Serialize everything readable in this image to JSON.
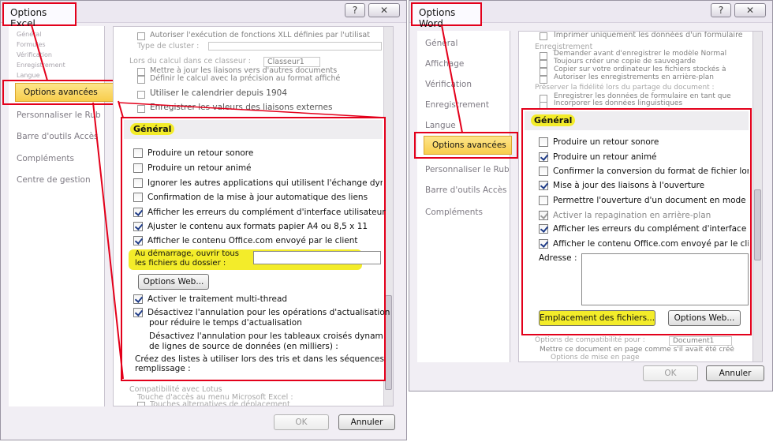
{
  "excel": {
    "title": "Options Excel",
    "help": "?",
    "nav": {
      "faded_top": [
        "Général",
        "Formules",
        "Vérification",
        "Enregistrement",
        "Langue"
      ],
      "selected": "Options avancées",
      "items": [
        "Personnaliser le Rub",
        "Barre d'outils Accès",
        "Compléments",
        "Centre de gestion"
      ]
    },
    "above": {
      "r1": "Autoriser l'exécution de fonctions XLL définies par l'utilisat",
      "r2": "Type de cluster :",
      "r3": "Lors du calcul dans ce classeur :",
      "r3b": "Classeur1",
      "r4": "Mettre à jour les liaisons vers d'autres documents",
      "r5": "Définir le calcul avec la précision au format affiché",
      "r6": "Utiliser le calendrier depuis 1904",
      "r7": "Enregistrer les valeurs des liaisons externes"
    },
    "section_title": "Général",
    "options": [
      {
        "label": "Produire un retour sonore",
        "checked": false
      },
      {
        "label": "Produire un retour animé",
        "checked": false
      },
      {
        "label": "Ignorer les autres applications qui utilisent l'échange dyna",
        "checked": false
      },
      {
        "label": "Confirmation de la mise à jour automatique des liens",
        "checked": false
      },
      {
        "label": "Afficher les erreurs du complément d'interface utilisateur",
        "checked": true
      },
      {
        "label": "Ajuster le contenu aux formats papier A4 ou 8,5 x 11",
        "checked": true
      },
      {
        "label": "Afficher le contenu Office.com envoyé par le client",
        "checked": true
      }
    ],
    "startup_label_1": "Au démarrage, ouvrir tous",
    "startup_label_2": "les fichiers du dossier :",
    "web_button": "Options Web...",
    "options2": [
      {
        "label": "Activer le traitement multi-thread",
        "checked": true
      },
      {
        "label": "Désactivez l'annulation pour les opérations d'actualisation",
        "checked": true
      }
    ],
    "opt2_cont": "pour réduire le temps d'actualisation",
    "note1a": "Désactivez l'annulation pour les tableaux croisés dynamiques",
    "note1b": "de lignes de source de données (en milliers) :",
    "note2a": "Créez des listes à utiliser lors des tris et dans les séquences de",
    "note2b": "remplissage :",
    "below": {
      "r1": "Compatibilité avec Lotus",
      "r2": "Touche d'accès au menu Microsoft Excel :",
      "r3": "Touches alternatives de déplacement"
    },
    "ok": "OK",
    "cancel": "Annuler"
  },
  "word": {
    "title": "Options Word",
    "help": "?",
    "nav": {
      "items_top": [
        "Général",
        "Affichage",
        "Vérification",
        "Enregistrement",
        "Langue"
      ],
      "selected": "Options avancées",
      "items": [
        "Personnaliser le Rub",
        "Barre d'outils Accès",
        "Compléments"
      ]
    },
    "above": {
      "r1": "Imprimer uniquement les données d'un formulaire",
      "r2": "Enregistrement",
      "r3": "Demander avant d'enregistrer le modèle Normal",
      "r4": "Toujours créer une copie de sauvegarde",
      "r5": "Copier sur votre ordinateur les fichiers stockés à",
      "r6": "Autoriser les enregistrements en arrière-plan",
      "r7": "Préserver la fidélité lors du partage du document :",
      "r8": "Enregistrer les données de formulaire en tant que",
      "r9": "Incorporer les données linguistiques"
    },
    "section_title": "Général",
    "options": [
      {
        "label": "Produire un retour sonore",
        "checked": false,
        "disabled": false
      },
      {
        "label": "Produire un retour animé",
        "checked": true,
        "disabled": false
      },
      {
        "label": "Confirmer la conversion du format de fichier lors",
        "checked": false,
        "disabled": false
      },
      {
        "label": "Mise à jour des liaisons à l'ouverture",
        "checked": true,
        "disabled": false
      },
      {
        "label": "Permettre l'ouverture d'un document en mode Br",
        "checked": false,
        "disabled": false
      },
      {
        "label": "Activer la repagination en arrière-plan",
        "checked": true,
        "disabled": true
      },
      {
        "label": "Afficher les erreurs du complément d'interface ut",
        "checked": true,
        "disabled": false
      },
      {
        "label": "Afficher le contenu Office.com envoyé par le clien",
        "checked": true,
        "disabled": false
      }
    ],
    "address_label": "Adresse :",
    "locations_button": "Emplacement des fichiers...",
    "web_button": "Options Web...",
    "below": {
      "r1": "Options de compatibilité pour :",
      "r1b": "Document1",
      "r2": "Mettre ce document en page comme s'il avait été créé",
      "r3": "Options de mise en page"
    },
    "ok": "OK",
    "cancel": "Annuler"
  }
}
